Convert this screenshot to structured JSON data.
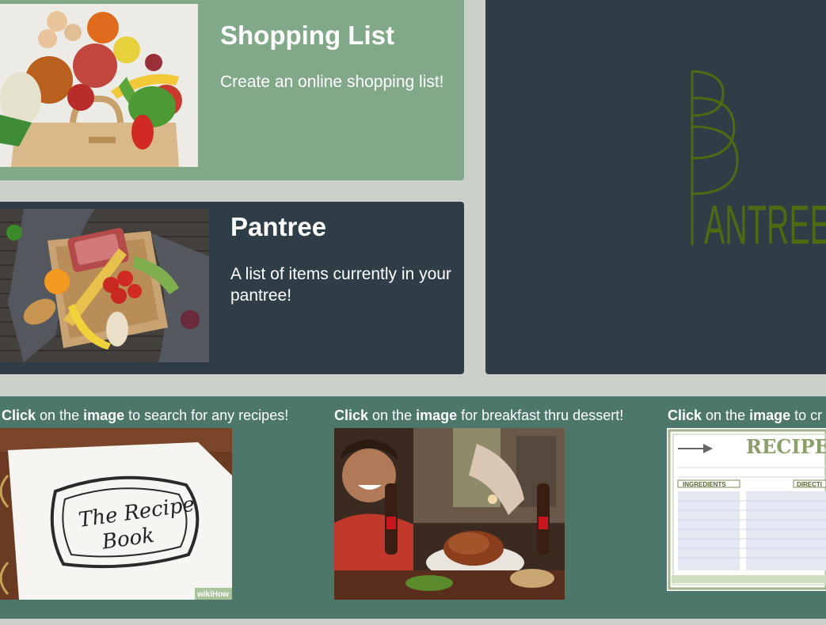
{
  "cards": {
    "shopping": {
      "title": "Shopping List",
      "description": "Create an online shopping list!",
      "image_icon": "grocery-bag-image"
    },
    "pantree": {
      "title": "Pantree",
      "description": "A list of items currently in your pantree!",
      "image_icon": "food-basket-image"
    }
  },
  "logo": {
    "text": "ANTREE",
    "icon": "pantree-logo-icon",
    "color": "#4d6b12"
  },
  "recipes": [
    {
      "click": "Click",
      "on_the": " on the ",
      "image": "image",
      "rest": " to search for any recipes!",
      "image_icon": "recipe-book-image",
      "image_text_1": "The Recipe",
      "image_text_2": "Book",
      "watermark": "wikiHow"
    },
    {
      "click": "Click",
      "on_the": " on the ",
      "image": "image",
      "rest": " for breakfast thru dessert!",
      "image_icon": "dinner-table-image"
    },
    {
      "click": "Click",
      "on_the": " on the ",
      "image": "image",
      "rest": " to cr",
      "image_icon": "recipe-card-image",
      "card_title": "RECIPE",
      "card_ingredients": "INGREDIENTS",
      "card_directions": "DIRECTI"
    }
  ],
  "colors": {
    "background": "#c9d1c8",
    "sage": "#82a88a",
    "slate": "#2f3d47",
    "teal": "#4e776b"
  }
}
